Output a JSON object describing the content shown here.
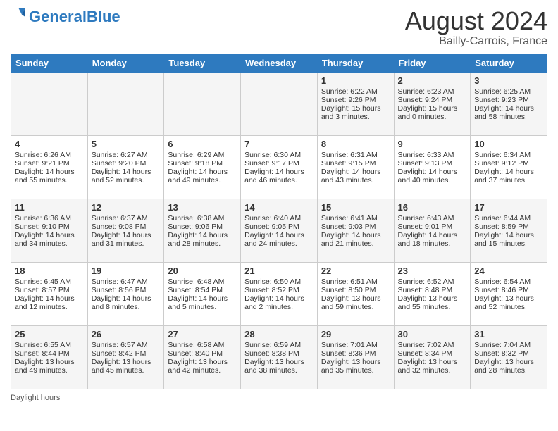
{
  "header": {
    "logo_general": "General",
    "logo_blue": "Blue",
    "month": "August 2024",
    "location": "Bailly-Carrois, France"
  },
  "days_of_week": [
    "Sunday",
    "Monday",
    "Tuesday",
    "Wednesday",
    "Thursday",
    "Friday",
    "Saturday"
  ],
  "weeks": [
    [
      {
        "day": "",
        "info": ""
      },
      {
        "day": "",
        "info": ""
      },
      {
        "day": "",
        "info": ""
      },
      {
        "day": "",
        "info": ""
      },
      {
        "day": "1",
        "info": "Sunrise: 6:22 AM\nSunset: 9:26 PM\nDaylight: 15 hours and 3 minutes."
      },
      {
        "day": "2",
        "info": "Sunrise: 6:23 AM\nSunset: 9:24 PM\nDaylight: 15 hours and 0 minutes."
      },
      {
        "day": "3",
        "info": "Sunrise: 6:25 AM\nSunset: 9:23 PM\nDaylight: 14 hours and 58 minutes."
      }
    ],
    [
      {
        "day": "4",
        "info": "Sunrise: 6:26 AM\nSunset: 9:21 PM\nDaylight: 14 hours and 55 minutes."
      },
      {
        "day": "5",
        "info": "Sunrise: 6:27 AM\nSunset: 9:20 PM\nDaylight: 14 hours and 52 minutes."
      },
      {
        "day": "6",
        "info": "Sunrise: 6:29 AM\nSunset: 9:18 PM\nDaylight: 14 hours and 49 minutes."
      },
      {
        "day": "7",
        "info": "Sunrise: 6:30 AM\nSunset: 9:17 PM\nDaylight: 14 hours and 46 minutes."
      },
      {
        "day": "8",
        "info": "Sunrise: 6:31 AM\nSunset: 9:15 PM\nDaylight: 14 hours and 43 minutes."
      },
      {
        "day": "9",
        "info": "Sunrise: 6:33 AM\nSunset: 9:13 PM\nDaylight: 14 hours and 40 minutes."
      },
      {
        "day": "10",
        "info": "Sunrise: 6:34 AM\nSunset: 9:12 PM\nDaylight: 14 hours and 37 minutes."
      }
    ],
    [
      {
        "day": "11",
        "info": "Sunrise: 6:36 AM\nSunset: 9:10 PM\nDaylight: 14 hours and 34 minutes."
      },
      {
        "day": "12",
        "info": "Sunrise: 6:37 AM\nSunset: 9:08 PM\nDaylight: 14 hours and 31 minutes."
      },
      {
        "day": "13",
        "info": "Sunrise: 6:38 AM\nSunset: 9:06 PM\nDaylight: 14 hours and 28 minutes."
      },
      {
        "day": "14",
        "info": "Sunrise: 6:40 AM\nSunset: 9:05 PM\nDaylight: 14 hours and 24 minutes."
      },
      {
        "day": "15",
        "info": "Sunrise: 6:41 AM\nSunset: 9:03 PM\nDaylight: 14 hours and 21 minutes."
      },
      {
        "day": "16",
        "info": "Sunrise: 6:43 AM\nSunset: 9:01 PM\nDaylight: 14 hours and 18 minutes."
      },
      {
        "day": "17",
        "info": "Sunrise: 6:44 AM\nSunset: 8:59 PM\nDaylight: 14 hours and 15 minutes."
      }
    ],
    [
      {
        "day": "18",
        "info": "Sunrise: 6:45 AM\nSunset: 8:57 PM\nDaylight: 14 hours and 12 minutes."
      },
      {
        "day": "19",
        "info": "Sunrise: 6:47 AM\nSunset: 8:56 PM\nDaylight: 14 hours and 8 minutes."
      },
      {
        "day": "20",
        "info": "Sunrise: 6:48 AM\nSunset: 8:54 PM\nDaylight: 14 hours and 5 minutes."
      },
      {
        "day": "21",
        "info": "Sunrise: 6:50 AM\nSunset: 8:52 PM\nDaylight: 14 hours and 2 minutes."
      },
      {
        "day": "22",
        "info": "Sunrise: 6:51 AM\nSunset: 8:50 PM\nDaylight: 13 hours and 59 minutes."
      },
      {
        "day": "23",
        "info": "Sunrise: 6:52 AM\nSunset: 8:48 PM\nDaylight: 13 hours and 55 minutes."
      },
      {
        "day": "24",
        "info": "Sunrise: 6:54 AM\nSunset: 8:46 PM\nDaylight: 13 hours and 52 minutes."
      }
    ],
    [
      {
        "day": "25",
        "info": "Sunrise: 6:55 AM\nSunset: 8:44 PM\nDaylight: 13 hours and 49 minutes."
      },
      {
        "day": "26",
        "info": "Sunrise: 6:57 AM\nSunset: 8:42 PM\nDaylight: 13 hours and 45 minutes."
      },
      {
        "day": "27",
        "info": "Sunrise: 6:58 AM\nSunset: 8:40 PM\nDaylight: 13 hours and 42 minutes."
      },
      {
        "day": "28",
        "info": "Sunrise: 6:59 AM\nSunset: 8:38 PM\nDaylight: 13 hours and 38 minutes."
      },
      {
        "day": "29",
        "info": "Sunrise: 7:01 AM\nSunset: 8:36 PM\nDaylight: 13 hours and 35 minutes."
      },
      {
        "day": "30",
        "info": "Sunrise: 7:02 AM\nSunset: 8:34 PM\nDaylight: 13 hours and 32 minutes."
      },
      {
        "day": "31",
        "info": "Sunrise: 7:04 AM\nSunset: 8:32 PM\nDaylight: 13 hours and 28 minutes."
      }
    ]
  ],
  "footer": {
    "label": "Daylight hours"
  }
}
